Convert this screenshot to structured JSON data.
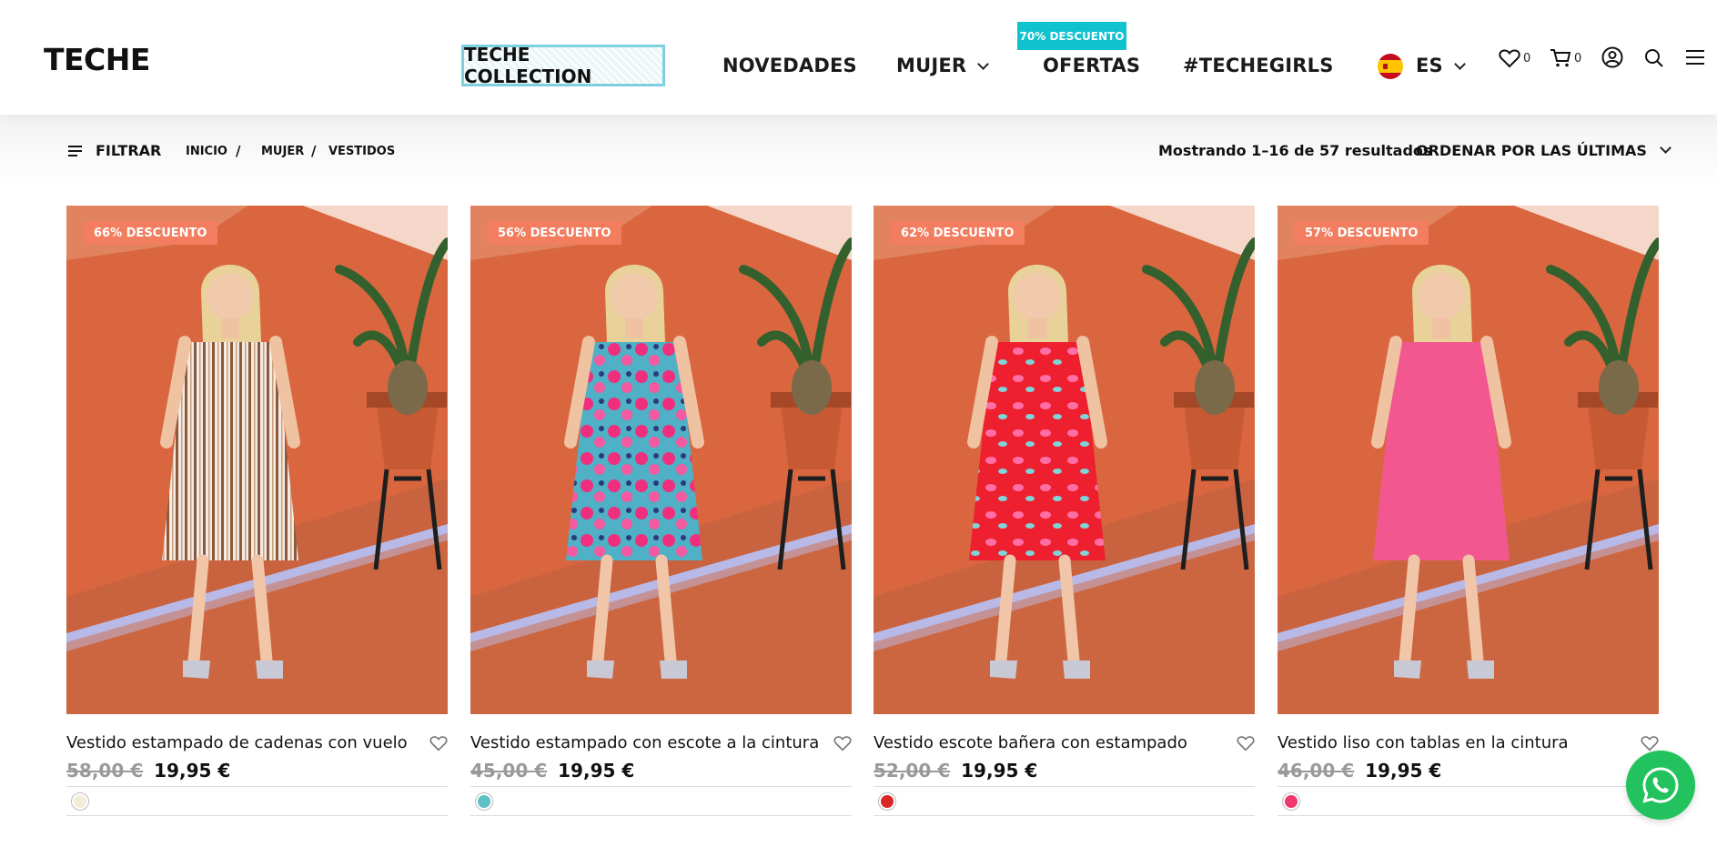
{
  "header": {
    "logo": "TECHE",
    "nav": {
      "collection": "TECHE COLLECTION",
      "novedades": "NOVEDADES",
      "mujer": "MUJER",
      "ofertas": "OFERTAS",
      "techegirls": "#TECHEGIRLS"
    },
    "ofertas_badge": "70% DESCUENTO",
    "language": "ES",
    "wishlist_count": "0",
    "cart_count": "0",
    "icons": [
      "heart-icon",
      "cart-icon",
      "account-icon",
      "search-icon",
      "menu-icon"
    ]
  },
  "toolbar": {
    "filter_label": "FILTRAR",
    "breadcrumb": [
      "INICIO",
      "MUJER",
      "VESTIDOS"
    ],
    "breadcrumb_sep": "/",
    "results_text": "Mostrando 1–16 de 57 resultados",
    "sort_label": "ORDENAR POR LAS ÚLTIMAS"
  },
  "products": [
    {
      "discount": "66% DESCUENTO",
      "name": "Vestido estampado de cadenas con vuelo",
      "old_price": "58,00 €",
      "price": "19,95 €",
      "swatch": "#f3ecd6",
      "dress": "stripes"
    },
    {
      "discount": "56% DESCUENTO",
      "name": "Vestido estampado con escote a la cintura",
      "old_price": "45,00 €",
      "price": "19,95 €",
      "swatch": "#5ec0c4",
      "dress": "floral-blue"
    },
    {
      "discount": "62% DESCUENTO",
      "name": "Vestido escote bañera con estampado",
      "old_price": "52,00 €",
      "price": "19,95 €",
      "swatch": "#d92626",
      "dress": "floral-red"
    },
    {
      "discount": "57% DESCUENTO",
      "name": "Vestido liso con tablas en la cintura",
      "old_price": "46,00 €",
      "price": "19,95 €",
      "swatch": "#f0386e",
      "dress": "pink"
    }
  ],
  "colors": {
    "accent": "#10c1ce",
    "whatsapp": "#22c35e",
    "discount_tag": "#f27d5f"
  }
}
